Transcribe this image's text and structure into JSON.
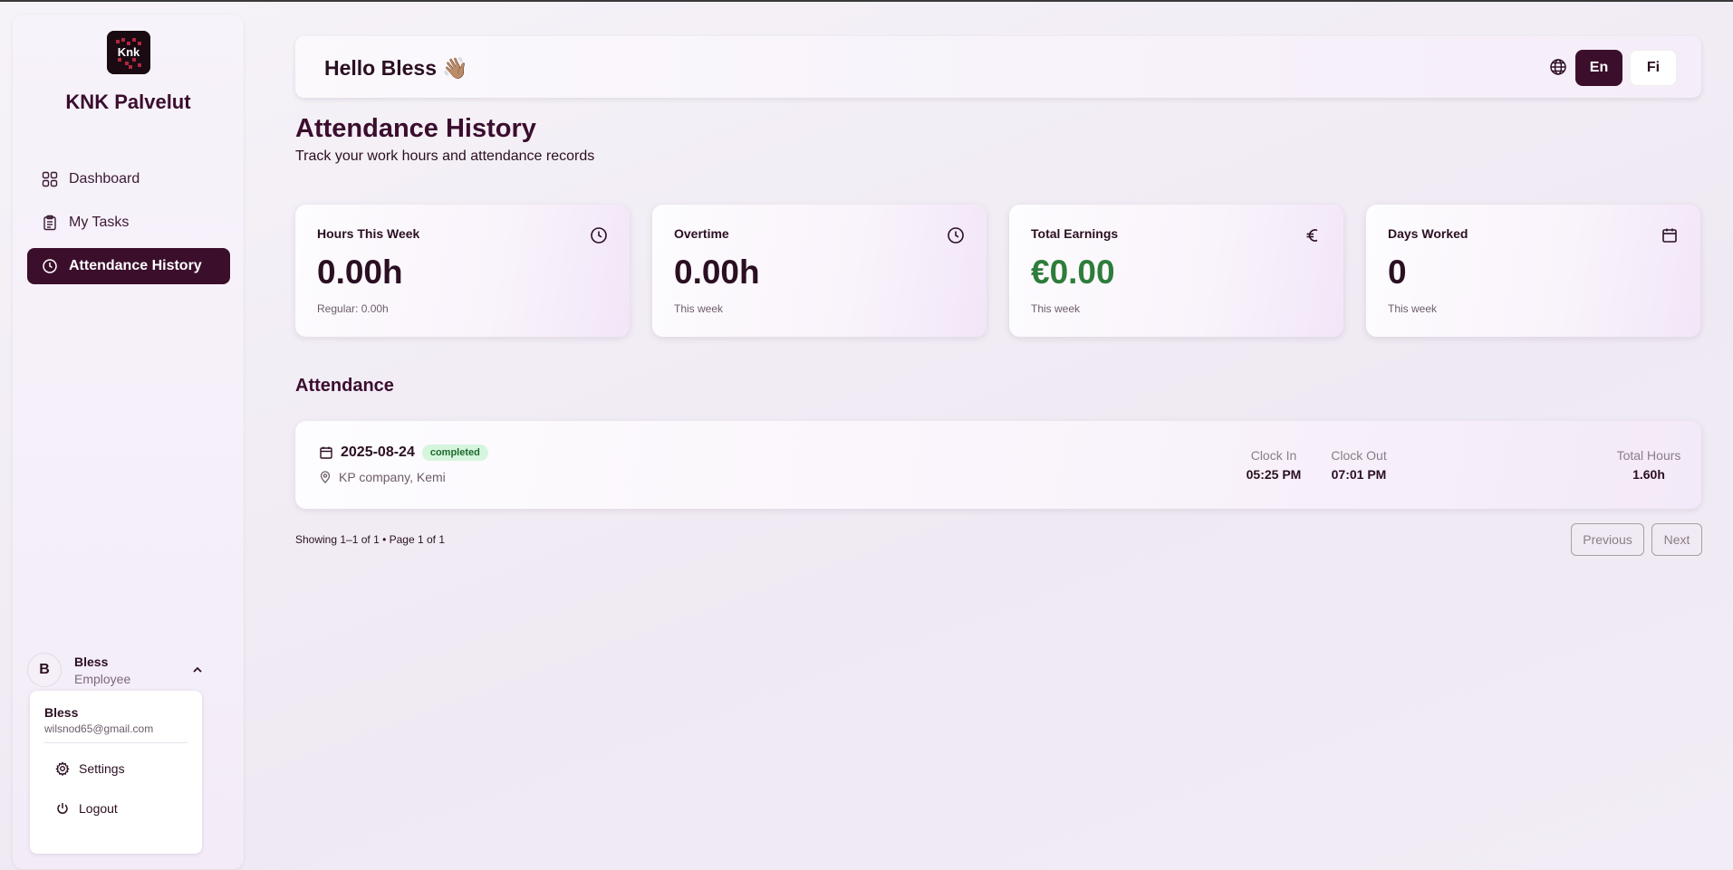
{
  "brand": {
    "name": "KNK Palvelut",
    "logo_text": "Knk"
  },
  "nav": {
    "items": [
      {
        "label": "Dashboard",
        "icon": "grid-icon",
        "active": false
      },
      {
        "label": "My Tasks",
        "icon": "clipboard-icon",
        "active": false
      },
      {
        "label": "Attendance History",
        "icon": "clock-icon",
        "active": true
      }
    ]
  },
  "user": {
    "initial": "B",
    "name": "Bless",
    "role": "Employee",
    "menu": {
      "name": "Bless",
      "email": "wilsnod65@gmail.com",
      "settings_label": "Settings",
      "logout_label": "Logout"
    }
  },
  "header": {
    "greeting": "Hello Bless 👋🏽",
    "lang_en": "En",
    "lang_fi": "Fi"
  },
  "page": {
    "title": "Attendance History",
    "subtitle": "Track your work hours and attendance records"
  },
  "stats": [
    {
      "label": "Hours This Week",
      "value": "0.00h",
      "note": "Regular: 0.00h",
      "icon": "clock-icon"
    },
    {
      "label": "Overtime",
      "value": "0.00h",
      "note": "This week",
      "icon": "clock-icon"
    },
    {
      "label": "Total Earnings",
      "value": "€0.00",
      "note": "This week",
      "icon": "euro-icon",
      "value_color": "#2e7d3b"
    },
    {
      "label": "Days Worked",
      "value": "0",
      "note": "This week",
      "icon": "calendar-icon"
    }
  ],
  "attendance": {
    "section_title": "Attendance",
    "records": [
      {
        "date": "2025-08-24",
        "status": "completed",
        "location": "KP company, Kemi",
        "clock_in_label": "Clock In",
        "clock_in": "05:25 PM",
        "clock_out_label": "Clock Out",
        "clock_out": "07:01 PM",
        "total_hours_label": "Total Hours",
        "total_hours": "1.60h"
      }
    ]
  },
  "pagination": {
    "summary": "Showing 1–1 of 1 • Page 1 of 1",
    "previous_label": "Previous",
    "next_label": "Next"
  },
  "colors": {
    "primary": "#3b0f2c",
    "earnings_green": "#2e7d3b",
    "badge_bg": "#d6f5dd"
  }
}
